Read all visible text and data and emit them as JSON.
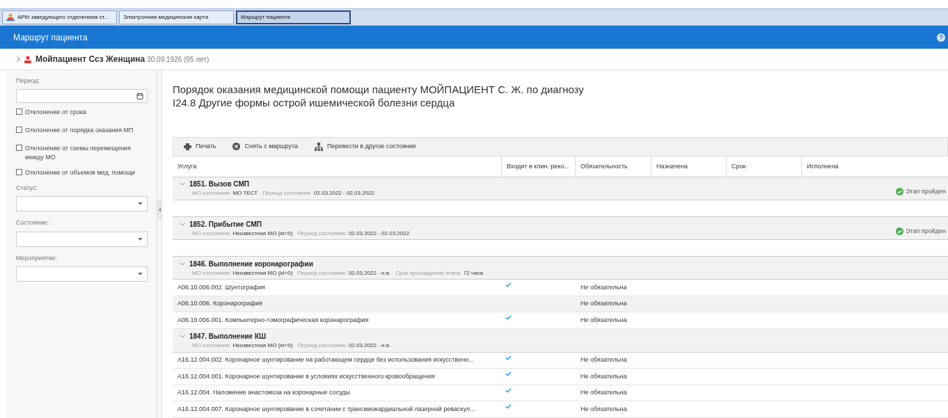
{
  "tabs": [
    {
      "label": "АРМ заведующего отделением ст...",
      "selected": false,
      "icon": true
    },
    {
      "label": "Электронная медицинская карта",
      "selected": false,
      "icon": false
    },
    {
      "label": "Маршрут пациента",
      "selected": true,
      "icon": false
    }
  ],
  "header": {
    "title": "Маршрут пациента"
  },
  "patient": {
    "name": "Мойпациент Ссз Женщина",
    "birth": "30.09.1926 (95 лет)"
  },
  "filters": {
    "period_label": "Период:",
    "checkboxes": [
      {
        "label": "Отклонение от срока",
        "checked": false
      },
      {
        "label": "Отклонение от порядка оказания МП",
        "checked": false
      },
      {
        "label": "Отклонение от схемы перемещения между МО",
        "checked": false
      },
      {
        "label": "Отклонение от объемов мед. помощи",
        "checked": false
      }
    ],
    "selects": [
      {
        "label": "Статус:"
      },
      {
        "label": "Состояние:"
      },
      {
        "label": "Мероприятие:"
      }
    ]
  },
  "title_lines": [
    "Порядок оказания медицинской помощи пациенту МОЙПАЦИЕНТ С. Ж. по диагнозу",
    "I24.8 Другие формы острой ишемической болезни сердца"
  ],
  "toolbar": [
    {
      "kind": "print",
      "label": "Печать"
    },
    {
      "kind": "remove",
      "label": "Снять с маршрута"
    },
    {
      "kind": "transfer",
      "label": "Перевести в другое состояние"
    }
  ],
  "table": {
    "columns": [
      "Услуга",
      "Входит в клин. реко...",
      "Обязательность",
      "Назначена",
      "Срок",
      "Исполнена"
    ],
    "rows": [
      {
        "kind": "group",
        "title": "1851. Вызов СМП",
        "fields": [
          {
            "label": "МО состояния:",
            "value": "МО ТЕСТ"
          },
          {
            "label": "Период состояния:",
            "value": "02.03.2022 - 02.03.2022"
          }
        ],
        "status": "Этап пройден"
      },
      {
        "kind": "empty"
      },
      {
        "kind": "group",
        "title": "1852. Прибытие СМП",
        "fields": [
          {
            "label": "МО состояния:",
            "value": "Неизвестная МО (id=0)"
          },
          {
            "label": "Период состояния:",
            "value": "02.03.2022 - 02.03.2022"
          }
        ],
        "status": "Этап пройден"
      },
      {
        "kind": "empty"
      },
      {
        "kind": "group",
        "title": "1846. Выполнение коронарографии",
        "fields": [
          {
            "label": "МО состояния:",
            "value": "Неизвестная МО (id=0)"
          },
          {
            "label": "Период состояния:",
            "value": "02.03.2022 - н.в."
          },
          {
            "label": "Срок прохождения этапа:",
            "value": "72 часа"
          }
        ]
      },
      {
        "kind": "item",
        "service": "A06.10.006.002. Шунтография",
        "included": true,
        "required": "Не обязательна",
        "selected": false
      },
      {
        "kind": "item",
        "service": "A06.10.006. Коронарография",
        "included": false,
        "required": "Не обязательна",
        "selected": true
      },
      {
        "kind": "item",
        "service": "A06.10.006.001. Компьютерно-томографическая коронарография",
        "included": true,
        "required": "Не обязательна",
        "selected": false
      },
      {
        "kind": "group",
        "title": "1847. Выполнение КШ",
        "fields": [
          {
            "label": "МО состояния:",
            "value": "Неизвестная МО (id=0)"
          },
          {
            "label": "Период состояния:",
            "value": "02.03.2022 - н.в."
          }
        ]
      },
      {
        "kind": "item",
        "service": "A16.12.004.002. Коронарное шунтирование на работающем сердце без использования искусственн...",
        "included": true,
        "required": "Не обязательна",
        "selected": false
      },
      {
        "kind": "item",
        "service": "A16.12.004.001. Коронарное шунтирование в условиях искусственного кровообращения",
        "included": true,
        "required": "Не обязательна",
        "selected": false
      },
      {
        "kind": "item",
        "service": "A16.12.004. Наложение анастомоза на коронарные сосуды",
        "included": true,
        "required": "Не обязательна",
        "selected": false
      },
      {
        "kind": "item",
        "service": "A16.12.004.007. Коронарное шунтирование в сочетании с трансмиокардиальной лазерной реваскул...",
        "included": true,
        "required": "Не обязательна",
        "selected": false
      }
    ]
  }
}
